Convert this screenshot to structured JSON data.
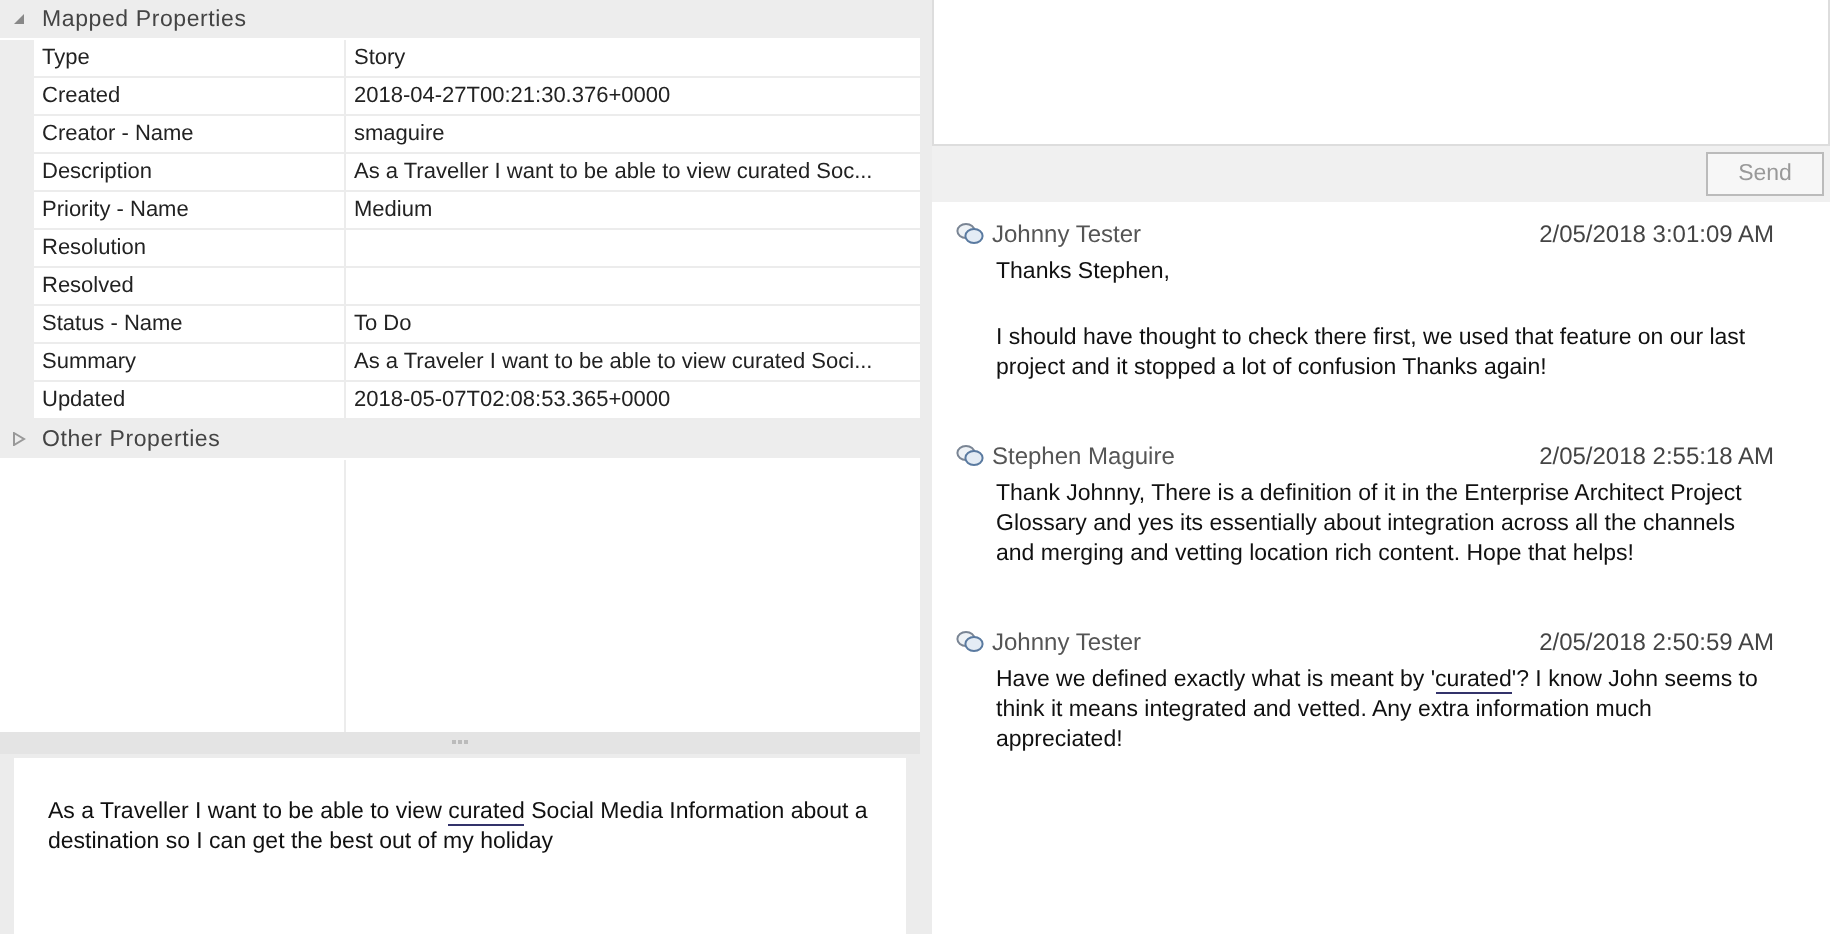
{
  "properties": {
    "sections": [
      {
        "title": "Mapped Properties",
        "expanded": true,
        "rows": [
          {
            "name": "Type",
            "value": "Story"
          },
          {
            "name": "Created",
            "value": "2018-04-27T00:21:30.376+0000"
          },
          {
            "name": "Creator - Name",
            "value": "smaguire"
          },
          {
            "name": "Description",
            "value": "As a Traveller I want to be able to view curated Soc..."
          },
          {
            "name": "Priority - Name",
            "value": "Medium"
          },
          {
            "name": "Resolution"
          },
          {
            "name": "Resolved"
          },
          {
            "name": "Status - Name",
            "value": "To Do"
          },
          {
            "name": "Summary",
            "value": "As a Traveler I want to be able to view curated Soci..."
          },
          {
            "name": "Updated",
            "value": "2018-05-07T02:08:53.365+0000"
          }
        ]
      },
      {
        "title": "Other Properties",
        "expanded": false
      }
    ]
  },
  "description": {
    "segments": [
      {
        "text": "As a Traveller I want to be able to view ",
        "kind": "text"
      },
      {
        "text": "curated",
        "kind": "link"
      },
      {
        "text": " Social Media Information about a destination so I can get the best out of my holiday",
        "kind": "text"
      }
    ]
  },
  "discussion": {
    "send_button": {
      "label": "Send",
      "disabled": true
    },
    "messages": [
      {
        "author": "Johnny Tester",
        "time": "2/05/2018 3:01:09 AM",
        "paragraphs": [
          [
            {
              "text": "Thanks Stephen,",
              "kind": "text"
            }
          ],
          [
            {
              "text": "I should have thought to check there first, we used that feature on our last project and it stopped a lot of confusion Thanks again!",
              "kind": "text"
            }
          ]
        ]
      },
      {
        "author": "Stephen Maguire",
        "time": "2/05/2018 2:55:18 AM",
        "paragraphs": [
          [
            {
              "text": "Thank Johnny, There is a definition of it in the Enterprise Architect Project Glossary and yes its essentially about integration across all the channels and merging and vetting location rich content. Hope that helps!",
              "kind": "text"
            }
          ]
        ]
      },
      {
        "author": "Johnny Tester",
        "time": "2/05/2018 2:50:59 AM",
        "paragraphs": [
          [
            {
              "text": "Have we defined exactly what is meant by '",
              "kind": "text"
            },
            {
              "text": "curated",
              "kind": "link"
            },
            {
              "text": "'? I know John seems to think it means integrated and vetted. Any extra information much appreciated!",
              "kind": "text"
            }
          ]
        ]
      }
    ]
  }
}
